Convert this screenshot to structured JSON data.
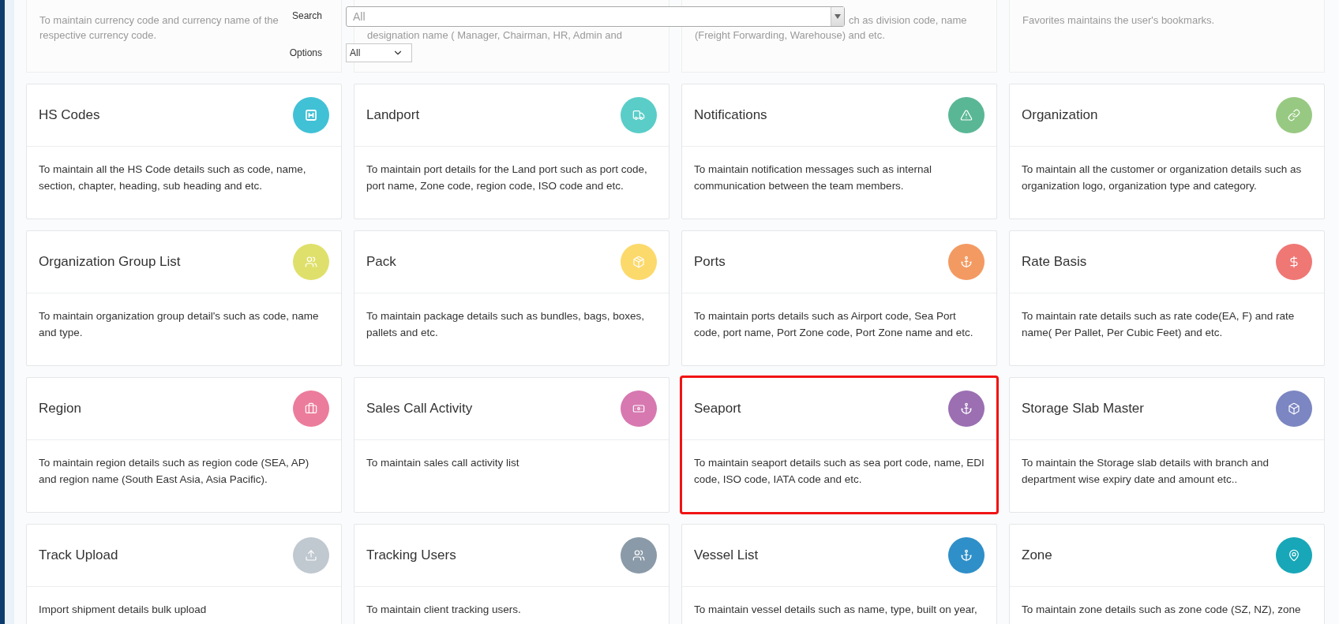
{
  "filter": {
    "search_label": "Search",
    "search_value": "All",
    "options_label": "Options",
    "options_value": "All"
  },
  "faded_row": [
    {
      "lines": [
        "To maintain currency code and currency name of the",
        "respective currency code."
      ]
    },
    {
      "lines": [
        "designation name ( Manager, Chairman, HR, Admin and"
      ]
    },
    {
      "lines": [
        "ch as division code, name",
        "(Freight Forwarding, Warehouse) and etc."
      ]
    },
    {
      "lines": [
        "Favorites maintains the user's bookmarks."
      ]
    }
  ],
  "cards": [
    {
      "title": "HS Codes",
      "description": "To maintain all the HS Code details such as code, name, section, chapter, heading, sub heading and etc.",
      "color": "#41c1d6",
      "highlighted": false
    },
    {
      "title": "Landport",
      "description": "To maintain port details for the Land port such as port code, port name, Zone code, region code, ISO code and etc.",
      "color": "#5acdc8",
      "highlighted": false
    },
    {
      "title": "Notifications",
      "description": "To maintain notification messages such as internal communication between the team members.",
      "color": "#5ab795",
      "highlighted": false
    },
    {
      "title": "Organization",
      "description": "To maintain all the customer or organization details such as organization logo, organization type and category.",
      "color": "#98c982",
      "highlighted": false
    },
    {
      "title": "Organization Group List",
      "description": "To maintain organization group detail's such as code, name and type.",
      "color": "#dfe06b",
      "highlighted": false
    },
    {
      "title": "Pack",
      "description": "To maintain package details such as bundles, bags, boxes, pallets and etc.",
      "color": "#fcd96b",
      "highlighted": false
    },
    {
      "title": "Ports",
      "description": "To maintain ports details such as Airport code, Sea Port code, port name, Port Zone code, Port Zone name and etc.",
      "color": "#f39a62",
      "highlighted": false
    },
    {
      "title": "Rate Basis",
      "description": "To maintain rate details such as rate code(EA, F) and rate name( Per Pallet, Per Cubic Feet) and etc.",
      "color": "#ef7774",
      "highlighted": false
    },
    {
      "title": "Region",
      "description": "To maintain region details such as region code (SEA, AP) and region name (South East Asia, Asia Pacific).",
      "color": "#ec7c9b",
      "highlighted": false
    },
    {
      "title": "Sales Call Activity",
      "description": "To maintain sales call activity list",
      "color": "#d778b0",
      "highlighted": false
    },
    {
      "title": "Seaport",
      "description": "To maintain seaport details such as sea port code, name, EDI code, ISO code, IATA code and etc.",
      "color": "#9b6fb2",
      "highlighted": true
    },
    {
      "title": "Storage Slab Master",
      "description": "To maintain the Storage slab details with branch and department wise expiry date and amount etc..",
      "color": "#7b86c2",
      "highlighted": false
    },
    {
      "title": "Track Upload",
      "description": "Import shipment details bulk upload",
      "color": "#c0c8d0",
      "highlighted": false
    },
    {
      "title": "Tracking Users",
      "description": "To maintain client tracking users.",
      "color": "#8a9aa8",
      "highlighted": false
    },
    {
      "title": "Vessel List",
      "description": "To maintain vessel details such as name, type, built on year,",
      "color": "#2f8fc8",
      "highlighted": false
    },
    {
      "title": "Zone",
      "description": "To maintain zone details such as zone code (SZ, NZ), zone",
      "color": "#17a7b8",
      "highlighted": false
    }
  ]
}
